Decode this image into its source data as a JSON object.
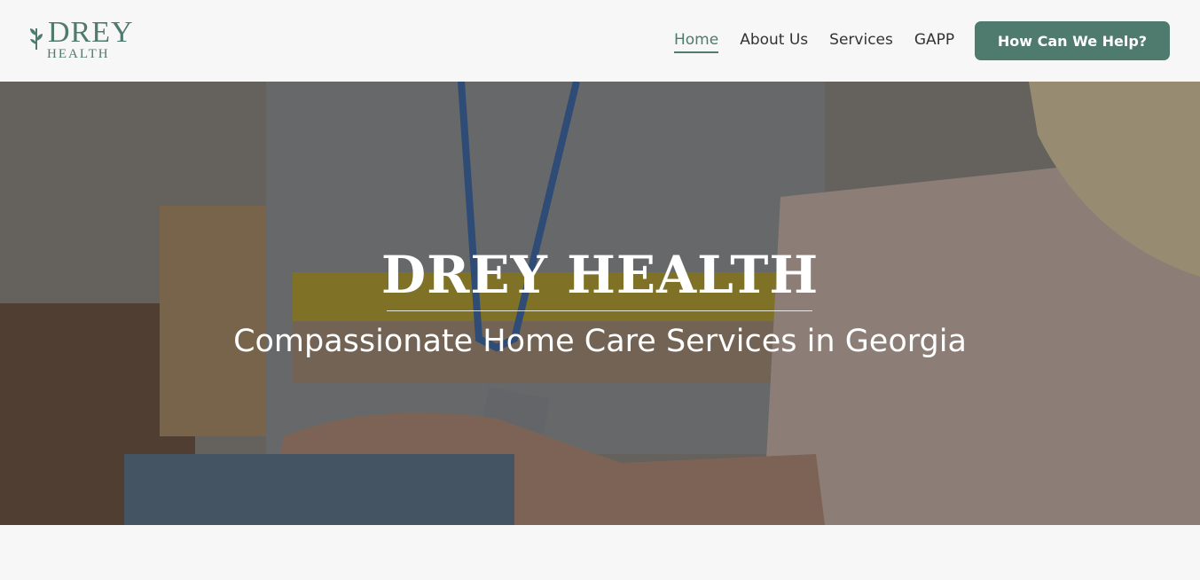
{
  "brand": {
    "name": "DREY",
    "sub": "HEALTH",
    "accent_color": "#4f7a6e"
  },
  "nav": {
    "items": [
      {
        "label": "Home",
        "active": true
      },
      {
        "label": "About Us",
        "active": false
      },
      {
        "label": "Services",
        "active": false
      },
      {
        "label": "GAPP",
        "active": false
      }
    ],
    "cta_label": "How Can We Help?"
  },
  "hero": {
    "title": "DREY HEALTH",
    "subtitle": "Compassionate Home Care Services in Georgia"
  },
  "icons": {
    "logo": "leaf-icon"
  }
}
